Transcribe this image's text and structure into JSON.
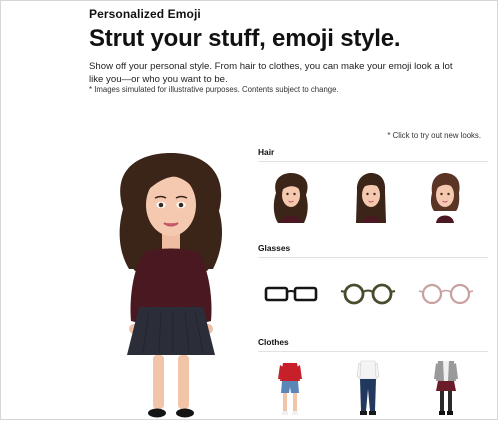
{
  "header": {
    "eyebrow": "Personalized Emoji",
    "headline": "Strut your stuff, emoji style.",
    "intro": "Show off your personal style. From hair to clothes, you can make your emoji look a lot like you—or who you want to be.",
    "disclaimer": "* Images simulated for illustrative purposes. Contents subject to change."
  },
  "note": "* Click to try out new looks.",
  "sections": {
    "hair": {
      "label": "Hair",
      "options": [
        "long-wavy-hair-option",
        "long-straight-hair-option",
        "bob-hair-option"
      ]
    },
    "glasses": {
      "label": "Glasses",
      "options": [
        "black-rectangle-glasses",
        "olive-round-glasses",
        "pink-round-glasses"
      ]
    },
    "clothes": {
      "label": "Clothes",
      "options": [
        "red-top-jean-shorts-outfit",
        "white-shirt-jeans-outfit",
        "grey-cardigan-maroon-skirt-outfit"
      ]
    }
  },
  "colors": {
    "hair": "#3b2418",
    "skin": "#f4c9b0",
    "top": "#4a1820",
    "skirt": "#2b2e38",
    "rule": "#e2e2e2",
    "glasses_black": "#151515",
    "glasses_olive": "#4a4a2c",
    "glasses_pink": "#c9a0a0"
  }
}
